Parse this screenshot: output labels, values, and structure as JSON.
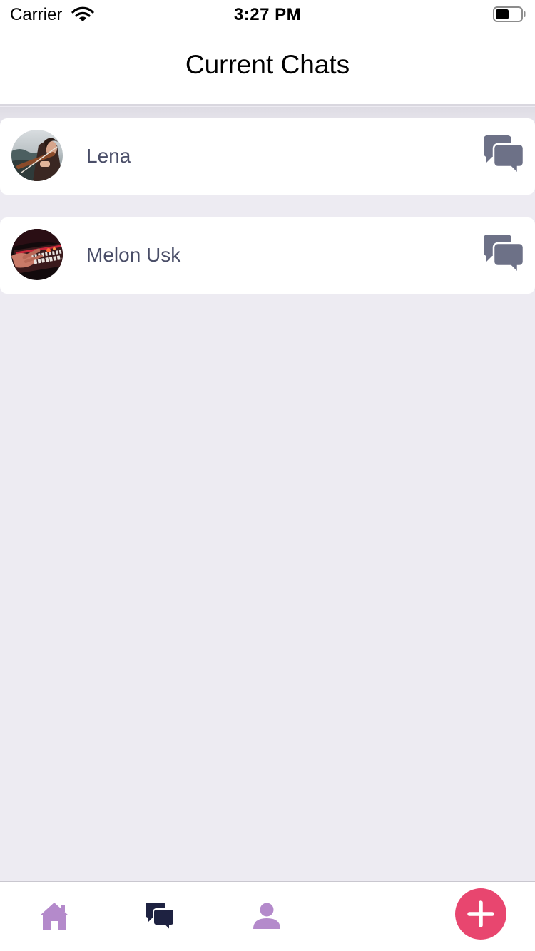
{
  "status_bar": {
    "carrier": "Carrier",
    "time": "3:27 PM",
    "wifi_icon": "wifi-icon",
    "battery_icon": "battery-icon"
  },
  "header": {
    "title": "Current Chats"
  },
  "chats": [
    {
      "name": "Lena",
      "avatar": "violinist-photo",
      "action_icon": "chat-bubbles-icon"
    },
    {
      "name": "Melon Usk",
      "avatar": "keyboard-hands-photo",
      "action_icon": "chat-bubbles-icon"
    }
  ],
  "tab_bar": {
    "tabs": [
      {
        "icon": "home-icon",
        "active": false
      },
      {
        "icon": "chat-bubbles-icon",
        "active": true
      },
      {
        "icon": "user-icon",
        "active": false
      }
    ],
    "fab_icon": "plus-icon"
  },
  "colors": {
    "background": "#edebf2",
    "name_text": "#4a4e68",
    "chat_icon": "#6d7187",
    "tab_inactive": "#b48acb",
    "tab_active": "#1e2241",
    "fab": "#e8466f"
  }
}
